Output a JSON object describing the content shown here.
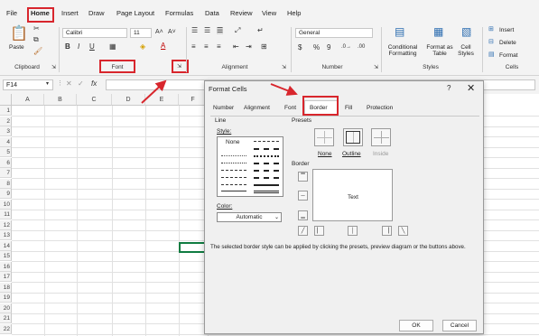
{
  "menu": {
    "tabs": [
      "File",
      "Home",
      "Insert",
      "Draw",
      "Page Layout",
      "Formulas",
      "Data",
      "Review",
      "View",
      "Help"
    ]
  },
  "ribbon": {
    "clipboard": {
      "paste_label": "Paste",
      "group_label": "Clipboard"
    },
    "font": {
      "font_name": "Calibri",
      "font_size": "11",
      "group_label": "Font",
      "bold": "B",
      "italic": "I",
      "underline": "U"
    },
    "alignment": {
      "group_label": "Alignment"
    },
    "number": {
      "format": "General",
      "group_label": "Number",
      "currency": "$",
      "percent": "%",
      "comma": "9"
    },
    "styles": {
      "conditional_formatting": "Conditional Formatting",
      "format_as_table": "Format as Table",
      "cell_styles": "Cell Styles",
      "group_label": "Styles"
    },
    "cells": {
      "insert": "Insert",
      "delete": "Delete",
      "format": "Format",
      "group_label": "Cells"
    }
  },
  "formula_bar": {
    "name_box": "F14",
    "fx": "fx"
  },
  "grid": {
    "columns": [
      "A",
      "B",
      "C",
      "D",
      "E",
      "F"
    ],
    "rows": [
      "1",
      "2",
      "3",
      "4",
      "5",
      "6",
      "7",
      "8",
      "9",
      "10",
      "11",
      "12",
      "13",
      "14",
      "15",
      "16",
      "17",
      "18",
      "19",
      "20",
      "21",
      "22"
    ]
  },
  "dialog": {
    "title": "Format Cells",
    "help": "?",
    "close": "✕",
    "tabs": [
      "Number",
      "Alignment",
      "Font",
      "Border",
      "Fill",
      "Protection"
    ],
    "line_section": {
      "heading": "Line",
      "style_label": "Style:",
      "none_option": "None",
      "color_label": "Color:",
      "color_value": "Automatic"
    },
    "presets_section": {
      "heading": "Presets",
      "none": "None",
      "outline": "Outline",
      "inside": "Inside"
    },
    "border_section": {
      "heading": "Border",
      "preview_text": "Text"
    },
    "help_text": "The selected border style can be applied by clicking the presets, preview diagram or the buttons above.",
    "ok": "OK",
    "cancel": "Cancel"
  },
  "colors": {
    "highlight_red": "#d8262d",
    "excel_green": "#107c41"
  }
}
